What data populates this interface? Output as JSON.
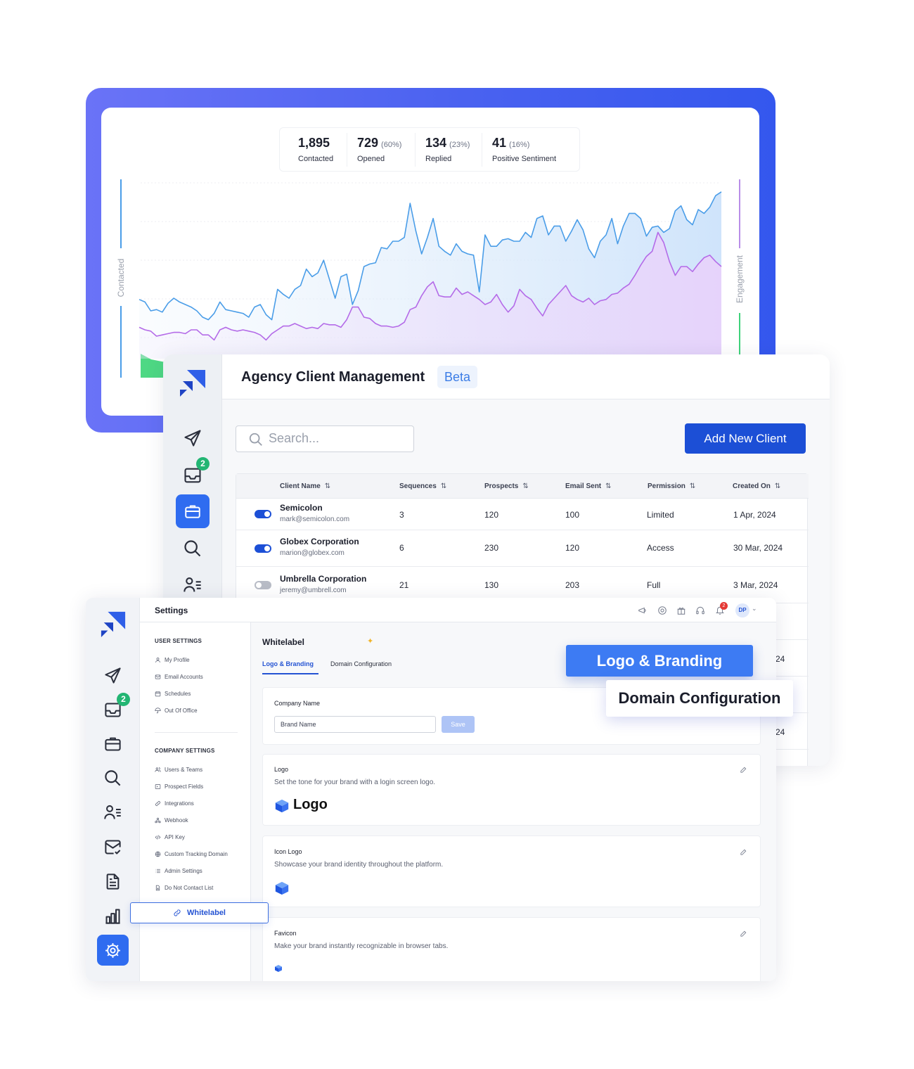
{
  "analytics": {
    "stats": [
      {
        "value": "1,895",
        "pct": "",
        "label": "Contacted"
      },
      {
        "value": "729",
        "pct": "(60%)",
        "label": "Opened"
      },
      {
        "value": "134",
        "pct": "(23%)",
        "label": "Replied"
      },
      {
        "value": "41",
        "pct": "(16%)",
        "label": "Positive Sentiment"
      }
    ],
    "left_axis_label": "Contacted",
    "right_axis_label": "Engagement"
  },
  "chart_data": {
    "type": "area",
    "title": "",
    "ylabel": "Contacted",
    "y2label": "Engagement",
    "grid": true,
    "colors": {
      "contacted": "#4a9de8",
      "engagement": "#b46be8",
      "positive": "#3fd27a"
    },
    "series": [
      {
        "values": [
          44,
          42,
          35,
          36,
          34,
          41,
          45,
          42,
          40,
          38,
          35,
          30,
          28,
          33,
          42,
          36,
          35,
          34,
          33,
          30,
          38,
          40,
          32,
          28,
          52,
          48,
          45,
          52,
          55,
          68,
          62,
          65,
          75,
          60,
          45,
          62,
          64,
          40,
          51,
          70,
          72,
          73,
          85,
          84,
          90,
          90,
          93,
          120,
          98,
          80,
          93,
          108,
          86,
          82,
          79,
          88,
          82,
          80,
          79,
          50,
          95,
          86,
          86,
          91,
          92,
          90,
          90,
          97,
          93,
          108,
          110,
          95,
          102,
          102,
          90,
          98,
          107,
          99,
          84,
          77,
          90,
          95,
          108,
          88,
          102,
          112,
          112,
          108,
          94,
          101,
          102,
          97,
          100,
          114,
          118,
          107,
          103,
          115,
          112,
          117,
          126,
          129
        ]
      },
      {
        "values": [
          22,
          20,
          19,
          15,
          16,
          17,
          18,
          18,
          17,
          20,
          20,
          16,
          16,
          12,
          20,
          22,
          20,
          19,
          20,
          19,
          18,
          16,
          12,
          17,
          20,
          23,
          23,
          25,
          23,
          21,
          22,
          21,
          25,
          24,
          24,
          22,
          28,
          38,
          38,
          30,
          29,
          25,
          23,
          23,
          22,
          23,
          26,
          36,
          38,
          47,
          54,
          58,
          47,
          46,
          46,
          53,
          48,
          50,
          47,
          44,
          40,
          42,
          48,
          40,
          34,
          39,
          52,
          47,
          44,
          37,
          31,
          40,
          45,
          50,
          55,
          47,
          44,
          42,
          45,
          40,
          43,
          44,
          48,
          49,
          53,
          56,
          63,
          71,
          78,
          82,
          97,
          89,
          74,
          63,
          70,
          70,
          66,
          72,
          77,
          79,
          74,
          70
        ]
      }
    ]
  },
  "agency": {
    "title": "Agency Client Management",
    "beta": "Beta",
    "search_placeholder": "Search...",
    "add_button": "Add New Client",
    "inbox_badge": "2",
    "columns": [
      "Client Name",
      "Sequences",
      "Prospects",
      "Email Sent",
      "Permission",
      "Created On"
    ],
    "clients": [
      {
        "name": "Semicolon",
        "email": "mark@semicolon.com",
        "sequences": "3",
        "prospects": "120",
        "sent": "100",
        "permission": "Limited",
        "created": "1 Apr, 2024",
        "enabled": true
      },
      {
        "name": "Globex Corporation",
        "email": "marion@globex.com",
        "sequences": "6",
        "prospects": "230",
        "sent": "120",
        "permission": "Access",
        "created": "30 Mar, 2024",
        "enabled": true
      },
      {
        "name": "Umbrella Corporation",
        "email": "jeremy@umbrell.com",
        "sequences": "21",
        "prospects": "130",
        "sent": "203",
        "permission": "Full",
        "created": "3 Mar, 2024",
        "enabled": false
      }
    ],
    "partial_dates": [
      "24",
      "24"
    ]
  },
  "settings": {
    "title": "Settings",
    "avatar": "DP",
    "notif_badge": "2",
    "inbox_badge": "2",
    "user_settings_label": "USER SETTINGS",
    "user_items": [
      "My Profile",
      "Email Accounts",
      "Schedules",
      "Out Of Office"
    ],
    "company_settings_label": "COMPANY SETTINGS",
    "company_items": [
      "Users & Teams",
      "Prospect Fields",
      "Integrations",
      "Webhook",
      "API Key",
      "Custom Tracking Domain",
      "Admin Settings",
      "Do Not Contact List"
    ],
    "whitelabel_item": "Whitelabel",
    "main": {
      "title": "Whitelabel",
      "tabs": [
        "Logo & Branding",
        "Domain Configuration"
      ],
      "company_name_label": "Company Name",
      "company_name_value": "Brand Name",
      "save_label": "Save",
      "logo_title": "Logo",
      "logo_desc": "Set the tone for your brand with a login screen logo.",
      "logo_text": "Logo",
      "icon_logo_title": "Icon Logo",
      "icon_logo_desc": "Showcase your brand identity throughout the platform.",
      "favicon_title": "Favicon",
      "favicon_desc": "Make your brand instantly recognizable in browser tabs."
    }
  },
  "overlays": {
    "logo_branding": "Logo & Branding",
    "domain_configuration": "Domain Configuration"
  }
}
